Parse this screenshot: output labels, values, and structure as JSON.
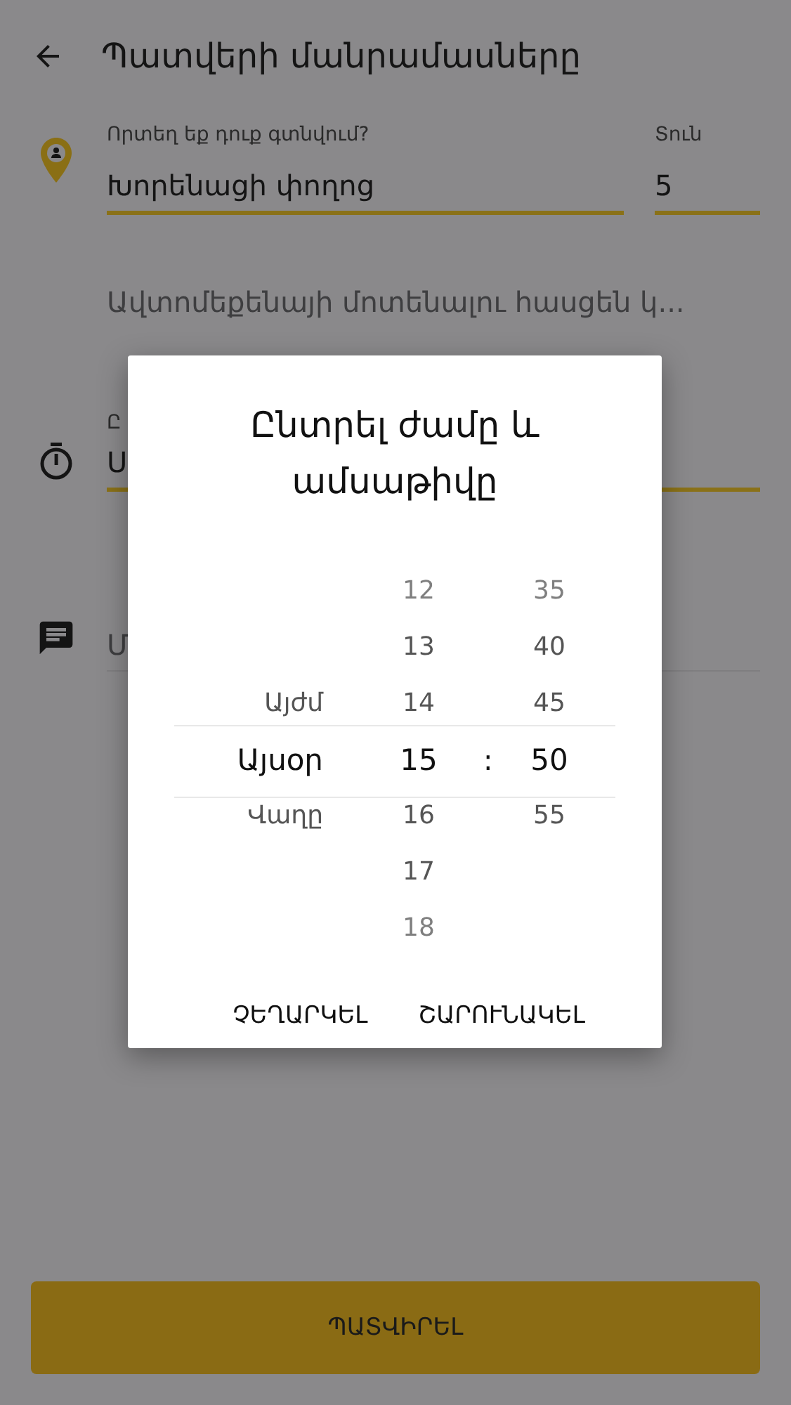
{
  "header": {
    "title": "Պատվերի մանրամասները"
  },
  "address": {
    "label": "Որտեղ եք դուք գտնվում?",
    "value": "Խորենացի փողոց"
  },
  "house": {
    "label": "Տուն",
    "value": "5"
  },
  "entrance": {
    "placeholder": "Ավտոմեքենայի մոտենալու հասցեն կ..."
  },
  "time_field": {
    "label": "Ը",
    "value": "Ս"
  },
  "comment": {
    "placeholder": "Մ"
  },
  "dialog": {
    "title": "Ընտրել ժամը և ամսաթիվը",
    "days": [
      {
        "label": "Այժմ",
        "selected": false
      },
      {
        "label": "Այսօր",
        "selected": true
      },
      {
        "label": "Վաղը",
        "selected": false
      }
    ],
    "hours": [
      {
        "label": "12",
        "selected": false
      },
      {
        "label": "13",
        "selected": false
      },
      {
        "label": "14",
        "selected": false
      },
      {
        "label": "15",
        "selected": true
      },
      {
        "label": "16",
        "selected": false
      },
      {
        "label": "17",
        "selected": false
      },
      {
        "label": "18",
        "selected": false
      }
    ],
    "separator": ":",
    "minutes": [
      {
        "label": "35",
        "selected": false
      },
      {
        "label": "40",
        "selected": false
      },
      {
        "label": "45",
        "selected": false
      },
      {
        "label": "50",
        "selected": true
      },
      {
        "label": "55",
        "selected": false
      }
    ],
    "buttons": [
      "ՉԵՂԱՐԿԵԼ",
      "ՇԱՐՈՒՆԱԿԵԼ"
    ]
  },
  "confirm_button": "ՊԱՏՎԻՐԵԼ"
}
